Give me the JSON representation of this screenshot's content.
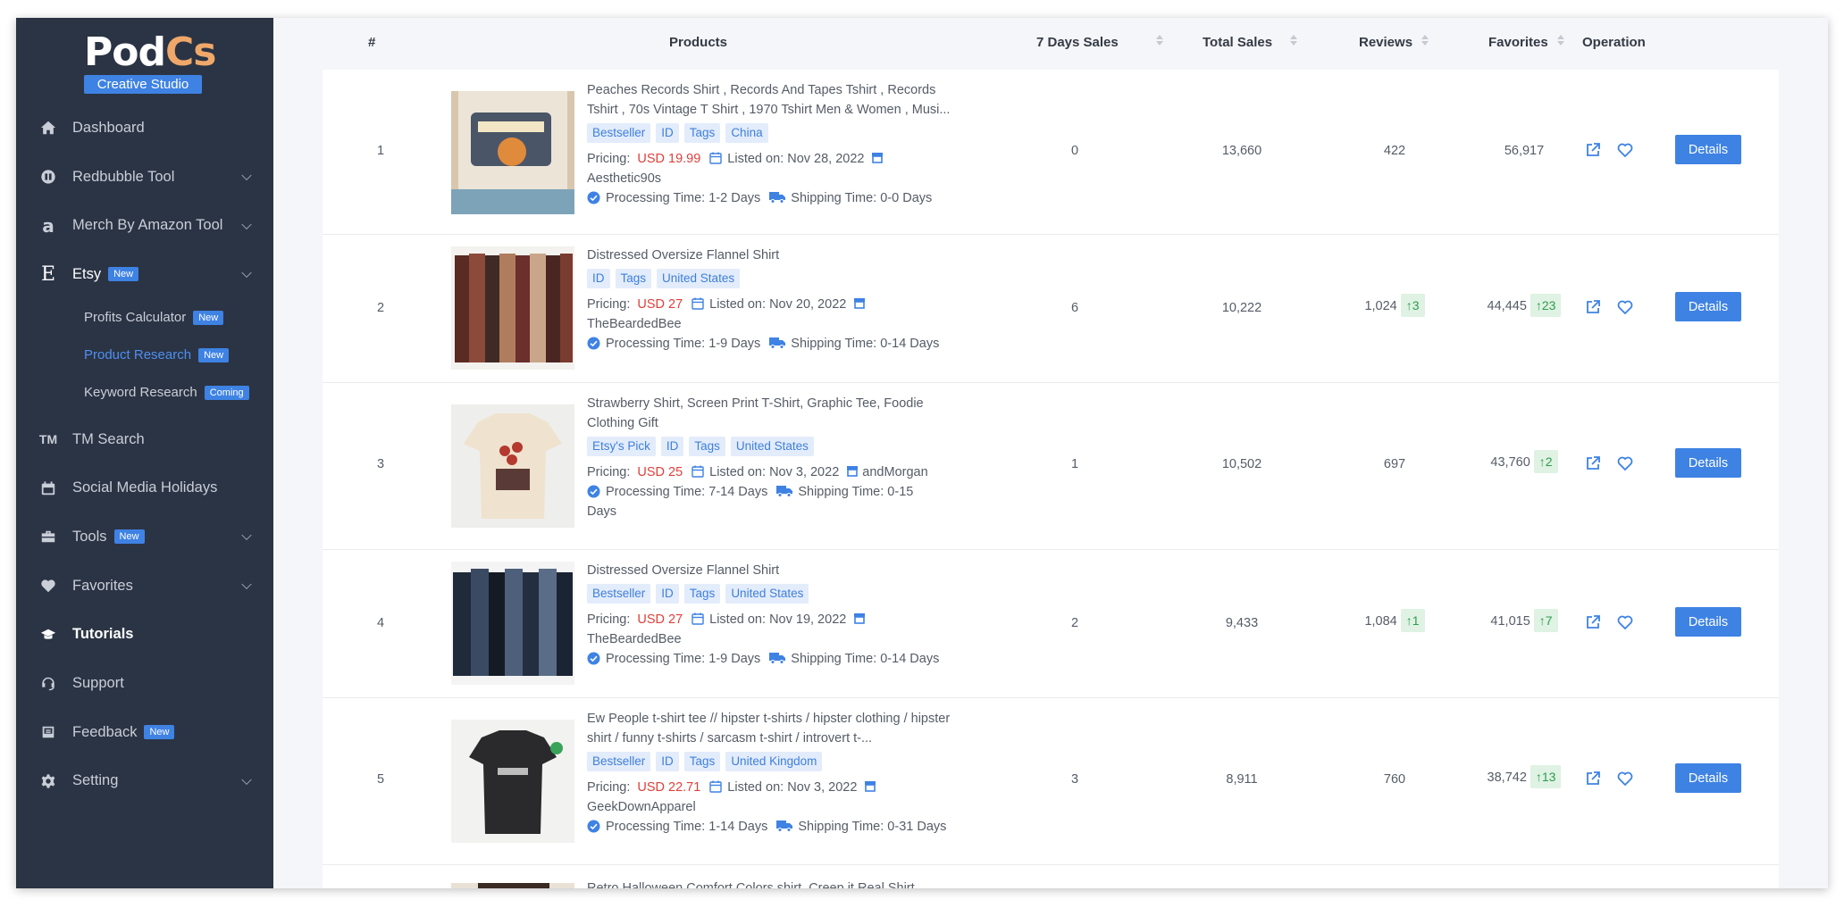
{
  "brand": {
    "name_part1": "Pod",
    "name_part2": "Cs",
    "tagline": "Creative Studio"
  },
  "colors": {
    "sidebar_bg": "#2b3444",
    "accent": "#3e82e4",
    "price": "#e0403a",
    "up": "#2d9d4f"
  },
  "sidebar": {
    "items": [
      {
        "label": "Dashboard",
        "icon": "home-icon"
      },
      {
        "label": "Redbubble Tool",
        "icon": "redbubble-icon"
      },
      {
        "label": "Merch By Amazon Tool",
        "icon": "amazon-icon"
      },
      {
        "label": "Etsy",
        "icon": "etsy-icon",
        "badge": "New"
      },
      {
        "label": "TM Search",
        "icon": "tm-icon"
      },
      {
        "label": "Social Media Holidays",
        "icon": "calendar-icon"
      },
      {
        "label": "Tools",
        "icon": "toolbox-icon",
        "badge": "New"
      },
      {
        "label": "Favorites",
        "icon": "heart-icon"
      },
      {
        "label": "Tutorials",
        "icon": "graduation-cap-icon"
      },
      {
        "label": "Support",
        "icon": "headset-icon"
      },
      {
        "label": "Feedback",
        "icon": "feedback-icon",
        "badge": "New"
      },
      {
        "label": "Setting",
        "icon": "gear-icon"
      }
    ],
    "etsy_sub": [
      {
        "label": "Profits Calculator",
        "badge": "New"
      },
      {
        "label": "Product Research",
        "badge": "New"
      },
      {
        "label": "Keyword Research",
        "badge": "Coming"
      }
    ]
  },
  "table": {
    "headers": {
      "rank": "#",
      "products": "Products",
      "sales7": "7 Days Sales",
      "total": "Total Sales",
      "reviews": "Reviews",
      "favorites": "Favorites",
      "operation": "Operation"
    },
    "pricing_label": "Pricing:",
    "listed_label": "Listed on:",
    "processing_label": "Processing Time:",
    "shipping_label": "Shipping Time:",
    "details_label": "Details",
    "rows": [
      {
        "rank": "1",
        "title": "Peaches Records Shirt , Records And Tapes Tshirt , Records Tshirt , 70s Vintage T Shirt , 1970 Tshirt Men & Women , Musi...",
        "tags": [
          "Bestseller",
          "ID",
          "Tags",
          "China"
        ],
        "price": "USD 19.99",
        "listed": "Nov 28, 2022",
        "shop": "Aesthetic90s",
        "processing": "1-2 Days",
        "shipping": "0-0 Days",
        "sales7": "0",
        "total": "13,660",
        "reviews": "422",
        "reviews_up": "",
        "favorites": "56,917",
        "favorites_up": ""
      },
      {
        "rank": "2",
        "title": "Distressed Oversize Flannel Shirt",
        "tags": [
          "ID",
          "Tags",
          "United States"
        ],
        "price": "USD 27",
        "listed": "Nov 20, 2022",
        "shop": "TheBeardedBee",
        "processing": "1-9 Days",
        "shipping": "0-14 Days",
        "sales7": "6",
        "total": "10,222",
        "reviews": "1,024",
        "reviews_up": "3",
        "favorites": "44,445",
        "favorites_up": "23"
      },
      {
        "rank": "3",
        "title": "Strawberry Shirt, Screen Print T-Shirt, Graphic Tee, Foodie Clothing Gift",
        "tags": [
          "Etsy's Pick",
          "ID",
          "Tags",
          "United States"
        ],
        "price": "USD 25",
        "listed": "Nov 3, 2022",
        "shop": "andMorgan",
        "processing": "7-14 Days",
        "shipping": "0-15 Days",
        "sales7": "1",
        "total": "10,502",
        "reviews": "697",
        "reviews_up": "",
        "favorites": "43,760",
        "favorites_up": "2"
      },
      {
        "rank": "4",
        "title": "Distressed Oversize Flannel Shirt",
        "tags": [
          "Bestseller",
          "ID",
          "Tags",
          "United States"
        ],
        "price": "USD 27",
        "listed": "Nov 19, 2022",
        "shop": "TheBeardedBee",
        "processing": "1-9 Days",
        "shipping": "0-14 Days",
        "sales7": "2",
        "total": "9,433",
        "reviews": "1,084",
        "reviews_up": "1",
        "favorites": "41,015",
        "favorites_up": "7"
      },
      {
        "rank": "5",
        "title": "Ew People t-shirt tee // hipster t-shirts / hipster clothing / hipster shirt / funny t-shirts / sarcasm t-shirt / introvert t-...",
        "tags": [
          "Bestseller",
          "ID",
          "Tags",
          "United Kingdom"
        ],
        "price": "USD 22.71",
        "listed": "Nov 3, 2022",
        "shop": "GeekDownApparel",
        "processing": "1-14 Days",
        "shipping": "0-31 Days",
        "sales7": "3",
        "total": "8,911",
        "reviews": "760",
        "reviews_up": "",
        "favorites": "38,742",
        "favorites_up": "13"
      },
      {
        "rank": "",
        "title": "Retro Halloween Comfort Colors shirt, Creep it Real Shirt"
      }
    ]
  }
}
